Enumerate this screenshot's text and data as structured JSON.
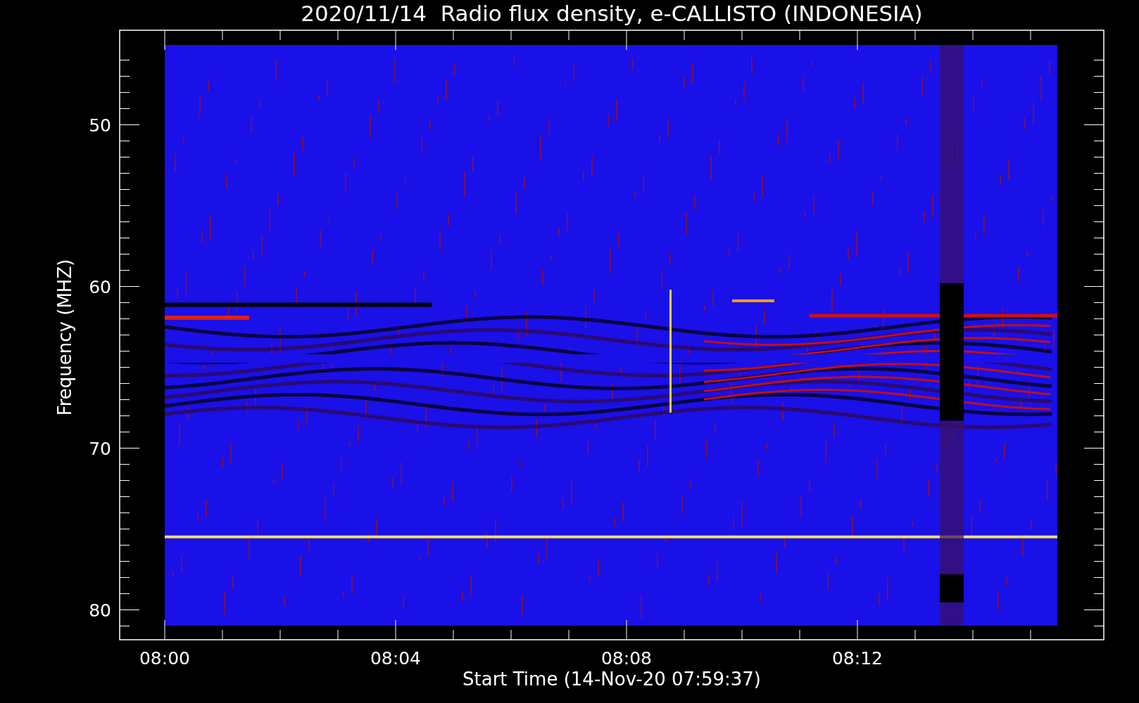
{
  "title": "2020/11/14  Radio flux density, e-CALLISTO (INDONESIA)",
  "y_axis": {
    "label": "Frequency (MHZ)",
    "ticks": [
      "50",
      "60",
      "70",
      "80"
    ]
  },
  "x_axis": {
    "label": "Start Time (14-Nov-20 07:59:37)",
    "ticks": [
      "08:00",
      "08:04",
      "08:08",
      "08:12"
    ]
  }
}
